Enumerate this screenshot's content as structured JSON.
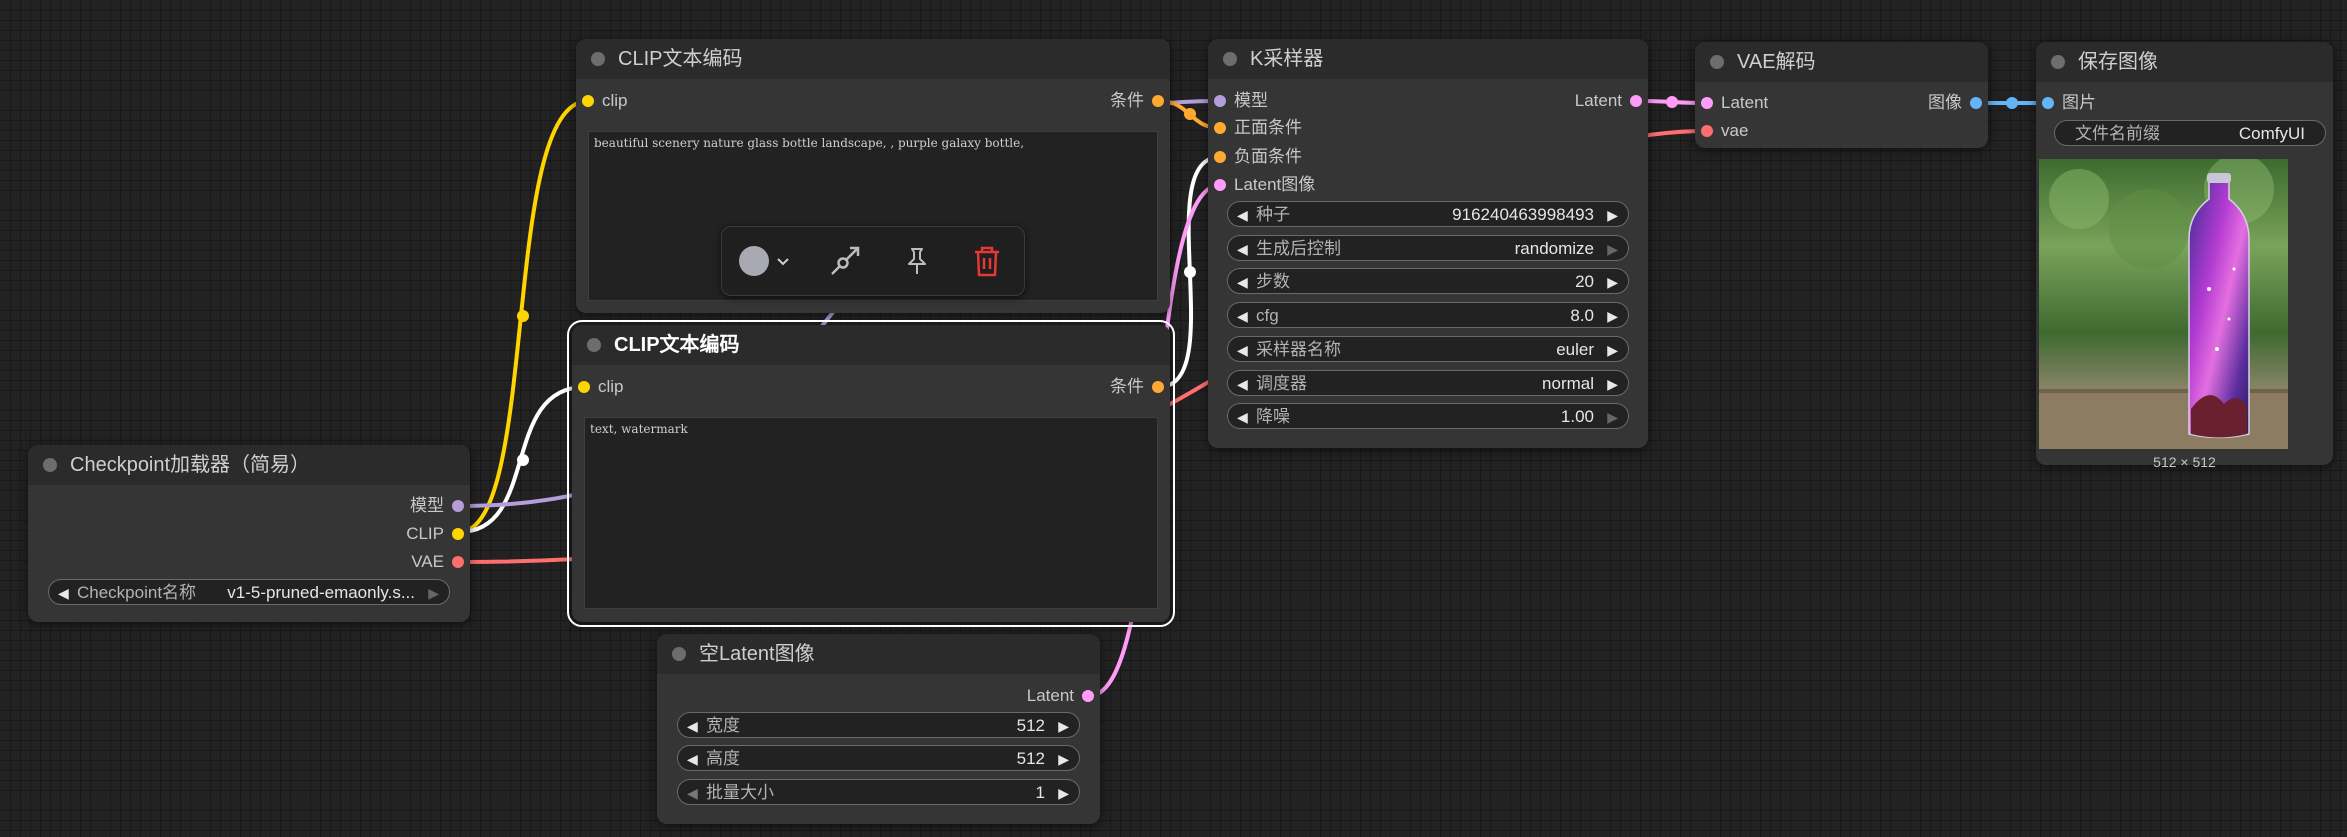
{
  "nodes": {
    "clip_positive": {
      "title": "CLIP文本编码",
      "input_clip": "clip",
      "output": "条件",
      "text": "beautiful scenery nature glass bottle landscape, , purple galaxy bottle,"
    },
    "clip_negative": {
      "title": "CLIP文本编码",
      "input_clip": "clip",
      "output": "条件",
      "text": "text, watermark"
    },
    "checkpoint": {
      "title": "Checkpoint加载器（简易）",
      "outputs": [
        "模型",
        "CLIP",
        "VAE"
      ],
      "widget_label": "Checkpoint名称",
      "widget_value": "v1-5-pruned-emaonly.s..."
    },
    "empty_latent": {
      "title": "空Latent图像",
      "output": "Latent",
      "widgets": [
        {
          "label": "宽度",
          "value": "512"
        },
        {
          "label": "高度",
          "value": "512"
        },
        {
          "label": "批量大小",
          "value": "1"
        }
      ]
    },
    "ksampler": {
      "title": "K采样器",
      "inputs": [
        "模型",
        "正面条件",
        "负面条件",
        "Latent图像"
      ],
      "output": "Latent",
      "widgets": [
        {
          "label": "种子",
          "value": "916240463998493"
        },
        {
          "label": "生成后控制",
          "value": "randomize"
        },
        {
          "label": "步数",
          "value": "20"
        },
        {
          "label": "cfg",
          "value": "8.0"
        },
        {
          "label": "采样器名称",
          "value": "euler"
        },
        {
          "label": "调度器",
          "value": "normal"
        },
        {
          "label": "降噪",
          "value": "1.00"
        }
      ]
    },
    "vae_decode": {
      "title": "VAE解码",
      "inputs": [
        "Latent",
        "vae"
      ],
      "output": "图像"
    },
    "save_image": {
      "title": "保存图像",
      "input": "图片",
      "widget_label": "文件名前缀",
      "widget_value": "ComfyUI",
      "caption": "512 × 512"
    }
  },
  "toolbar": {
    "color_icon": "color-circle-icon",
    "bypass_icon": "bypass-icon",
    "pin_icon": "pin-icon",
    "delete_icon": "trash-icon"
  },
  "colors": {
    "model": "#b39ddb",
    "clip": "#ffd500",
    "vae": "#ff6e6e",
    "conditioning": "#ffa931",
    "latent": "#ff9cf9",
    "image": "#64b5f6",
    "delete": "#e53935"
  }
}
